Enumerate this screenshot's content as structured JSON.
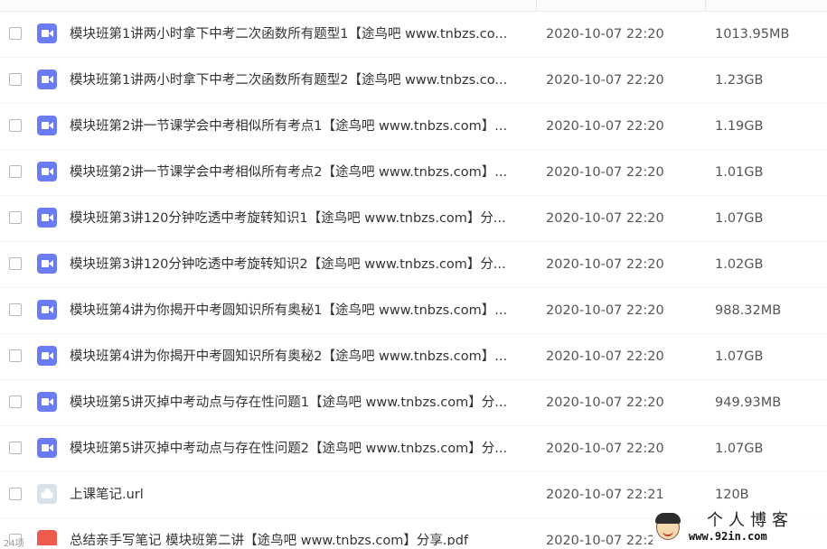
{
  "files": [
    {
      "icon": "video",
      "name": "模块班第1讲两小时拿下中考二次函数所有题型1【途鸟吧 www.tnbzs.co...",
      "time": "2020-10-07 22:20",
      "size": "1013.95MB"
    },
    {
      "icon": "video",
      "name": "模块班第1讲两小时拿下中考二次函数所有题型2【途鸟吧 www.tnbzs.co...",
      "time": "2020-10-07 22:20",
      "size": "1.23GB"
    },
    {
      "icon": "video",
      "name": "模块班第2讲一节课学会中考相似所有考点1【途鸟吧 www.tnbzs.com】...",
      "time": "2020-10-07 22:20",
      "size": "1.19GB"
    },
    {
      "icon": "video",
      "name": "模块班第2讲一节课学会中考相似所有考点2【途鸟吧 www.tnbzs.com】...",
      "time": "2020-10-07 22:20",
      "size": "1.01GB"
    },
    {
      "icon": "video",
      "name": "模块班第3讲120分钟吃透中考旋转知识1【途鸟吧 www.tnbzs.com】分...",
      "time": "2020-10-07 22:20",
      "size": "1.07GB"
    },
    {
      "icon": "video",
      "name": "模块班第3讲120分钟吃透中考旋转知识2【途鸟吧 www.tnbzs.com】分...",
      "time": "2020-10-07 22:20",
      "size": "1.02GB"
    },
    {
      "icon": "video",
      "name": "模块班第4讲为你揭开中考圆知识所有奥秘1【途鸟吧 www.tnbzs.com】...",
      "time": "2020-10-07 22:20",
      "size": "988.32MB"
    },
    {
      "icon": "video",
      "name": "模块班第4讲为你揭开中考圆知识所有奥秘2【途鸟吧 www.tnbzs.com】...",
      "time": "2020-10-07 22:20",
      "size": "1.07GB"
    },
    {
      "icon": "video",
      "name": "模块班第5讲灭掉中考动点与存在性问题1【途鸟吧 www.tnbzs.com】分...",
      "time": "2020-10-07 22:20",
      "size": "949.93MB"
    },
    {
      "icon": "video",
      "name": "模块班第5讲灭掉中考动点与存在性问题2【途鸟吧 www.tnbzs.com】分...",
      "time": "2020-10-07 22:20",
      "size": "1.07GB"
    },
    {
      "icon": "url",
      "name": "上课笔记.url",
      "time": "2020-10-07 22:21",
      "size": "120B"
    },
    {
      "icon": "pdf",
      "name": "总结亲手写笔记 模块班第二讲【途鸟吧 www.tnbzs.com】分享.pdf",
      "time": "2020-10-07 22:2",
      "size": ""
    }
  ],
  "footer": {
    "text": "24项"
  },
  "watermark": {
    "title": "个人博客",
    "url": "www.92in.com"
  },
  "colors": {
    "video_icon": "#6a7cf5",
    "url_icon": "#d9e1ea",
    "pdf_icon": "#ef5a4f"
  }
}
